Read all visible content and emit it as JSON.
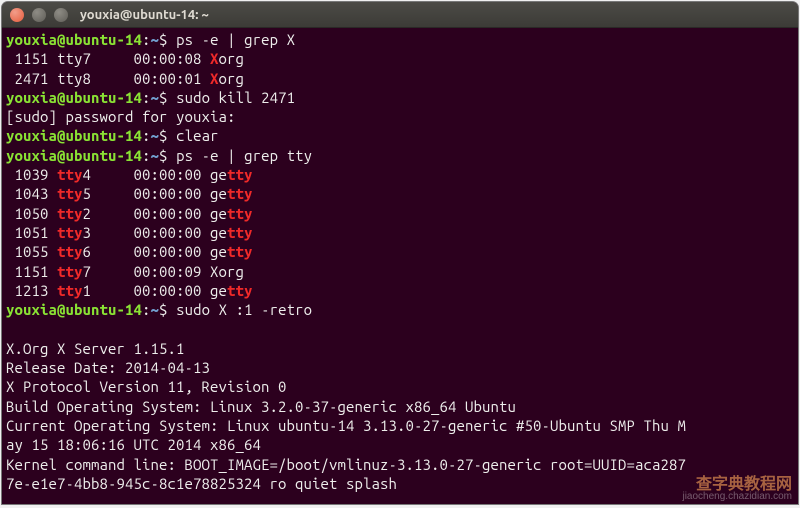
{
  "window": {
    "title": "youxia@ubuntu-14: ~"
  },
  "prompt": {
    "user_host": "youxia@ubuntu-14",
    "colon": ":",
    "path": "~",
    "symbol": "$"
  },
  "commands": {
    "cmd1": "ps -e | grep X",
    "cmd2": "sudo kill 2471",
    "cmd3": "clear",
    "cmd4": "ps -e | grep tty",
    "cmd5": "sudo X :1 -retro"
  },
  "sudo_prompt": "[sudo] password for youxia:",
  "grepX": [
    {
      "pid": " 1151",
      "tty": "tty7",
      "time": "00:00:08",
      "pre": "",
      "hl": "X",
      "post": "org"
    },
    {
      "pid": " 2471",
      "tty": "tty8",
      "time": "00:00:01",
      "pre": "",
      "hl": "X",
      "post": "org"
    }
  ],
  "greptty": [
    {
      "pid": " 1039",
      "ttypre": "",
      "ttyhl": "tty",
      "ttypost": "4",
      "time": "00:00:00",
      "cpre": "ge",
      "chl": "tty",
      "cpost": ""
    },
    {
      "pid": " 1043",
      "ttypre": "",
      "ttyhl": "tty",
      "ttypost": "5",
      "time": "00:00:00",
      "cpre": "ge",
      "chl": "tty",
      "cpost": ""
    },
    {
      "pid": " 1050",
      "ttypre": "",
      "ttyhl": "tty",
      "ttypost": "2",
      "time": "00:00:00",
      "cpre": "ge",
      "chl": "tty",
      "cpost": ""
    },
    {
      "pid": " 1051",
      "ttypre": "",
      "ttyhl": "tty",
      "ttypost": "3",
      "time": "00:00:00",
      "cpre": "ge",
      "chl": "tty",
      "cpost": ""
    },
    {
      "pid": " 1055",
      "ttypre": "",
      "ttyhl": "tty",
      "ttypost": "6",
      "time": "00:00:00",
      "cpre": "ge",
      "chl": "tty",
      "cpost": ""
    },
    {
      "pid": " 1151",
      "ttypre": "",
      "ttyhl": "tty",
      "ttypost": "7",
      "time": "00:00:09",
      "cpre": "Xorg",
      "chl": "",
      "cpost": ""
    },
    {
      "pid": " 1213",
      "ttypre": "",
      "ttyhl": "tty",
      "ttypost": "1",
      "time": "00:00:00",
      "cpre": "ge",
      "chl": "tty",
      "cpost": ""
    }
  ],
  "xorg_output": {
    "l1": "X.Org X Server 1.15.1",
    "l2": "Release Date: 2014-04-13",
    "l3": "X Protocol Version 11, Revision 0",
    "l4": "Build Operating System: Linux 3.2.0-37-generic x86_64 Ubuntu",
    "l5": "Current Operating System: Linux ubuntu-14 3.13.0-27-generic #50-Ubuntu SMP Thu M",
    "l6": "ay 15 18:06:16 UTC 2014 x86_64",
    "l7": "Kernel command line: BOOT_IMAGE=/boot/vmlinuz-3.13.0-27-generic root=UUID=aca287",
    "l8": "7e-e1e7-4bb8-945c-8c1e78825324 ro quiet splash"
  },
  "watermark": {
    "logo": "查字典教程网",
    "url": "jiaocheng.chazidian.com"
  }
}
